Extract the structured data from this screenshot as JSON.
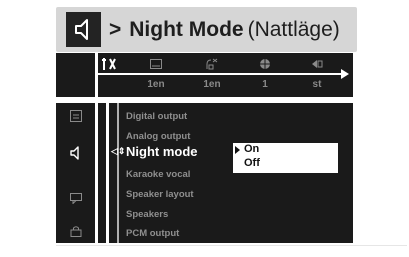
{
  "header": {
    "separator": ">",
    "title": "Night Mode",
    "translation": "(Nattläge)",
    "icon": "speaker-icon"
  },
  "menubar": {
    "icons": [
      "tools-icon",
      "subtitle-icon",
      "audio-icon",
      "angle-icon",
      "chapter-icon"
    ],
    "values": [
      "1en",
      "1en",
      "1",
      "st"
    ]
  },
  "sidebar": {
    "icons": [
      "disc-icon",
      "speaker-icon",
      "chat-icon",
      "lock-icon"
    ]
  },
  "menu": {
    "items": [
      "Digital output",
      "Analog output",
      "Night mode",
      "Karaoke vocal",
      "Speaker layout",
      "Speakers",
      "PCM output"
    ],
    "selected_index": 2,
    "selector_glyph": "◁⇕"
  },
  "options": {
    "items": [
      "On",
      "Off"
    ],
    "selected": "On"
  },
  "colors": {
    "screen_bg": "#1a1a1a",
    "banner_bg": "#d6d6d6",
    "dim_text": "#8f8f8f",
    "active_text": "#ffffff"
  }
}
